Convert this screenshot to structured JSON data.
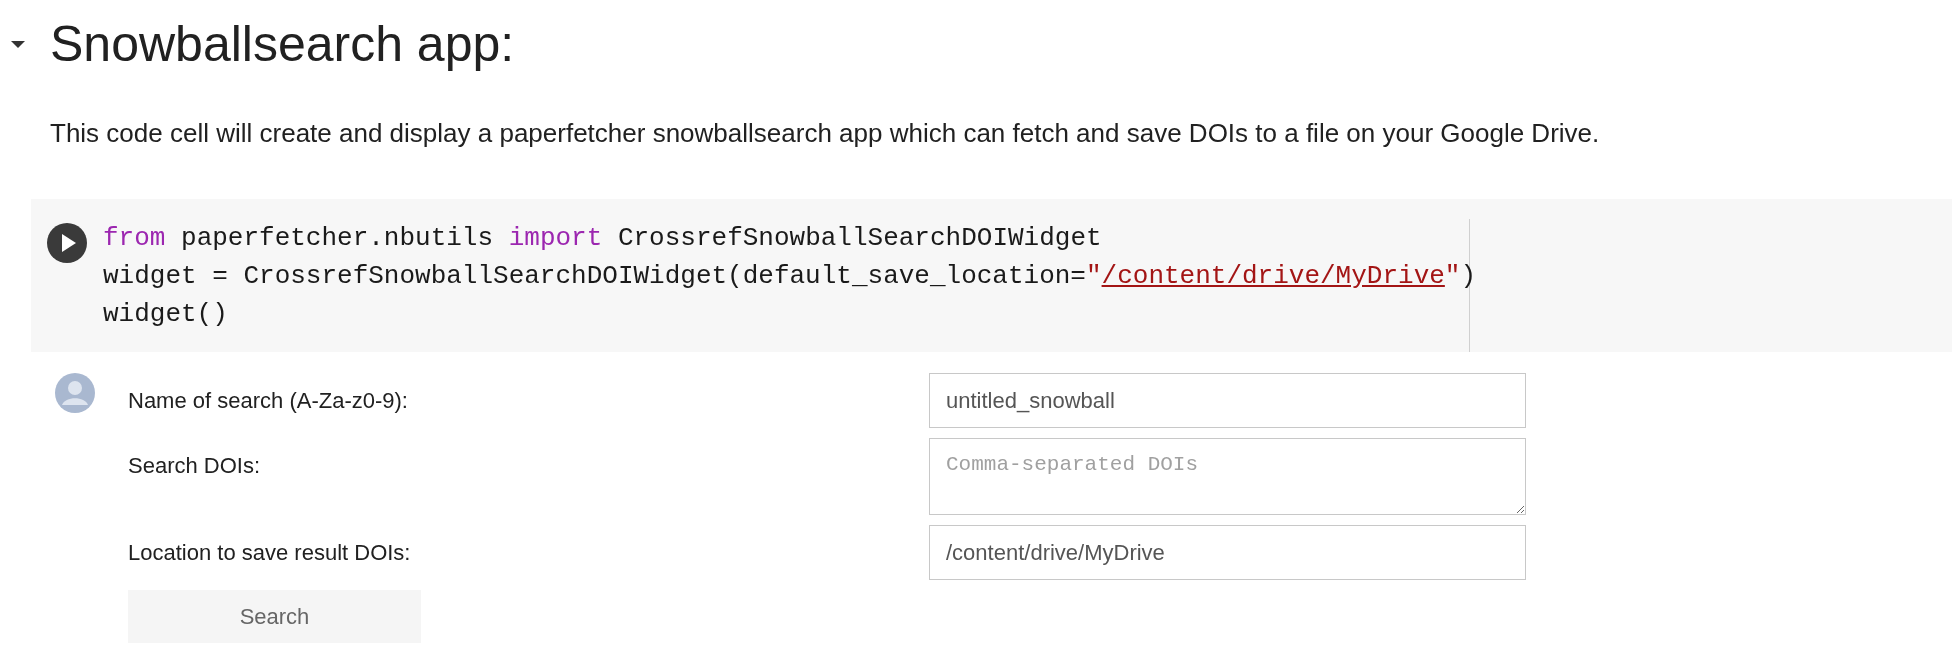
{
  "heading": {
    "title": "Snowballsearch app:",
    "expanded": true
  },
  "description": "This code cell will create and display a paperfetcher snowballsearch app which can fetch and save DOIs to a file on your Google Drive.",
  "code_cell": {
    "lines": [
      [
        {
          "kind": "keyword",
          "text": "from"
        },
        {
          "kind": "plain",
          "text": " paperfetcher.nbutils "
        },
        {
          "kind": "keyword",
          "text": "import"
        },
        {
          "kind": "plain",
          "text": " CrossrefSnowballSearchDOIWidget"
        }
      ],
      [
        {
          "kind": "plain",
          "text": "widget = CrossrefSnowballSearchDOIWidget(default_save_location="
        },
        {
          "kind": "string",
          "text": "\""
        },
        {
          "kind": "link",
          "text": "/content/drive/MyDrive"
        },
        {
          "kind": "string",
          "text": "\""
        },
        {
          "kind": "plain",
          "text": ")"
        }
      ],
      [
        {
          "kind": "plain",
          "text": "widget()"
        }
      ]
    ]
  },
  "form": {
    "fields": [
      {
        "label": "Name of search (A-Za-z0-9):",
        "kind": "text",
        "value": "untitled_snowball"
      },
      {
        "label": "Search DOIs:",
        "kind": "textarea",
        "placeholder": "Comma-separated DOIs"
      },
      {
        "label": "Location to save result DOIs:",
        "kind": "text",
        "value": "/content/drive/MyDrive"
      }
    ],
    "button": "Search"
  }
}
